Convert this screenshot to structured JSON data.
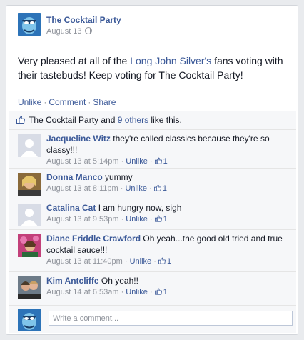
{
  "post": {
    "page_name": "The Cocktail Party",
    "date": "August 13",
    "text_before": "Very pleased at all of the ",
    "text_link": "Long John Silver's",
    "text_after": " fans voting with their tastebuds! Keep voting for The Cocktail Party!"
  },
  "actions": {
    "unlike": "Unlike",
    "comment": "Comment",
    "share": "Share",
    "sep": "·"
  },
  "likes": {
    "prefix": "The Cocktail Party and ",
    "others": "9 others",
    "suffix": " like this."
  },
  "comments": [
    {
      "author": "Jacqueline Witz",
      "text": " they're called classics because they're so classy!!!",
      "time": "August 13 at 5:14pm",
      "unlike": "Unlike",
      "likes": "1",
      "avatar": "default"
    },
    {
      "author": "Donna Manco",
      "text": " yummy",
      "time": "August 13 at 8:11pm",
      "unlike": "Unlike",
      "likes": "1",
      "avatar": "photo"
    },
    {
      "author": "Catalina Cat",
      "text": " I am hungry now, sigh",
      "time": "August 13 at 9:53pm",
      "unlike": "Unlike",
      "likes": "1",
      "avatar": "default"
    },
    {
      "author": "Diane Friddle Crawford",
      "text": " Oh yeah...the good old tried and true cocktail sauce!!!",
      "time": "August 13 at 11:40pm",
      "unlike": "Unlike",
      "likes": "1",
      "avatar": "photo"
    },
    {
      "author": "Kim Antcliffe",
      "text": " Oh yeah!!",
      "time": "August 14 at 6:53am",
      "unlike": "Unlike",
      "likes": "1",
      "avatar": "photo"
    }
  ],
  "composer": {
    "placeholder": "Write a comment..."
  },
  "colors": {
    "link": "#3b5998",
    "meta": "#90949c",
    "feedback_bg": "#f6f7f9",
    "brand_avatar": "#2c73b8"
  }
}
